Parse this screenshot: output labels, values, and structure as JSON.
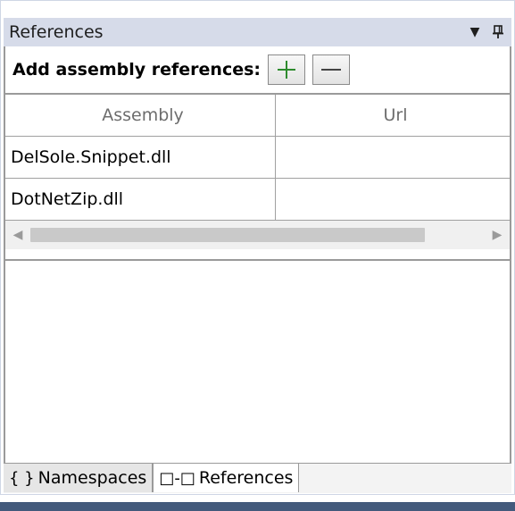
{
  "panel": {
    "title": "References",
    "dropdown_icon": "dropdown-arrow-icon",
    "pin_icon": "pin-icon"
  },
  "toolbar": {
    "label": "Add assembly references:",
    "add_icon": "plus-icon",
    "remove_icon": "minus-icon",
    "accent_add": "#2e8b2e"
  },
  "grid": {
    "columns": [
      "Assembly",
      "Url"
    ],
    "rows": [
      {
        "assembly": "DelSole.Snippet.dll",
        "url": ""
      },
      {
        "assembly": "DotNetZip.dll",
        "url": ""
      }
    ]
  },
  "tabs": [
    {
      "icon": "braces-icon",
      "label": "Namespaces",
      "active": false,
      "glyph": "{ }"
    },
    {
      "icon": "references-icon",
      "label": "References",
      "active": true,
      "glyph": "□-□"
    }
  ]
}
